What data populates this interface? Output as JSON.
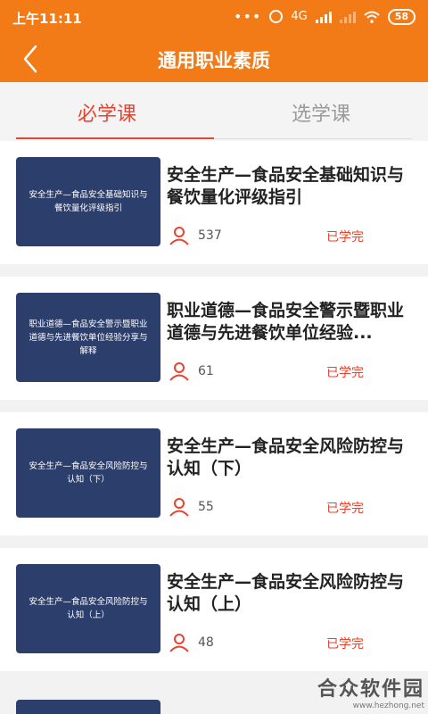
{
  "status_bar": {
    "time": "上午11:11",
    "network": "4G",
    "battery": "58"
  },
  "header": {
    "title": "通用职业素质",
    "back_icon": "chevron-left-icon"
  },
  "tabs": [
    {
      "label": "必学课",
      "active": true
    },
    {
      "label": "选学课",
      "active": false
    }
  ],
  "courses": [
    {
      "thumb_text": "安全生产—食品安全基础知识与餐饮量化评级指引",
      "title": "安全生产—食品安全基础知识与餐饮量化评级指引",
      "count": "537",
      "status": "已学完"
    },
    {
      "thumb_text": "职业道德—食品安全警示暨职业道德与先进餐饮单位经验分享与解释",
      "title": "职业道德—食品安全警示暨职业道德与先进餐饮单位经验...",
      "count": "61",
      "status": "已学完"
    },
    {
      "thumb_text": "安全生产—食品安全风险防控与认知（下）",
      "title": "安全生产—食品安全风险防控与认知（下）",
      "count": "55",
      "status": "已学完"
    },
    {
      "thumb_text": "安全生产—食品安全风险防控与认知（上）",
      "title": "安全生产—食品安全风险防控与认知（上）",
      "count": "48",
      "status": "已学完"
    }
  ],
  "colors": {
    "header_orange": "#f27a17",
    "accent_red": "#e8432e",
    "thumb_navy": "#2c3e6b"
  },
  "watermark": {
    "name": "合众软件园",
    "url": "www.hezhong.net"
  }
}
